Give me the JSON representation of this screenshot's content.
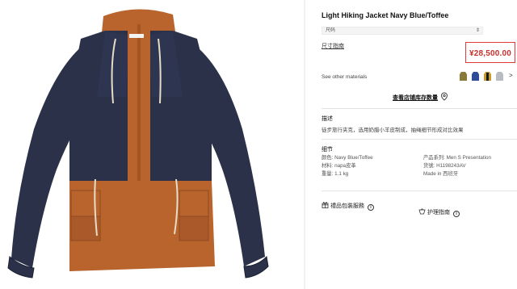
{
  "product": {
    "title": "Light Hiking Jacket Navy Blue/Toffee",
    "price": "¥28,500.00",
    "size_select": {
      "value": "尺码",
      "caret": "⇕"
    },
    "size_guide_label": "尺寸指南",
    "see_materials_label": "See other materials",
    "swatch_more": ">",
    "swatches": [
      {
        "name": "swatch-olive-jacket",
        "color": "#8a7a3a"
      },
      {
        "name": "swatch-blue-jacket",
        "color": "#2f4c9a"
      },
      {
        "name": "swatch-gold-black-jacket",
        "color": "#c79a2a"
      },
      {
        "name": "swatch-grey-jacket",
        "color": "#b9bcc2"
      }
    ],
    "store_stock_label": "查看店铺库存数量"
  },
  "description": {
    "heading": "描述",
    "text": "徒步旅行夹克，选用奶腊小羊皮制成，抽绳细节形成对比效果"
  },
  "details": {
    "heading": "细节",
    "left": [
      "颜色: Navy Blue/Toffee",
      "材料: napa皮革",
      "重量: 1.1 kg"
    ],
    "right": [
      "产品系列: Men S Presentation",
      "货號: H1198243AV",
      "Made in  西班牙"
    ]
  },
  "actions": {
    "gift_label": "禮品包裝服務",
    "care_label": "护理指南",
    "info_glyph": "i"
  },
  "colors": {
    "navy": "#2b3148",
    "toffee": "#b8642c",
    "price_red": "#c9302c"
  }
}
